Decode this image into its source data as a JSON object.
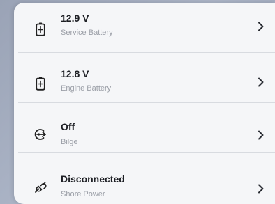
{
  "list": {
    "items": [
      {
        "value": "12.9 V",
        "label": "Service Battery",
        "icon": "battery-icon"
      },
      {
        "value": "12.8 V",
        "label": "Engine Battery",
        "icon": "battery-icon"
      },
      {
        "value": "Off",
        "label": "Bilge",
        "icon": "bilge-pump-icon"
      },
      {
        "value": "Disconnected",
        "label": "Shore Power",
        "icon": "plug-disconnected-icon"
      }
    ]
  },
  "colors": {
    "background": "#a3acbf",
    "card": "#f5f6f8",
    "value_text": "#1d1f24",
    "label_text": "#9b9fa7",
    "divider": "#d8dbe0"
  }
}
